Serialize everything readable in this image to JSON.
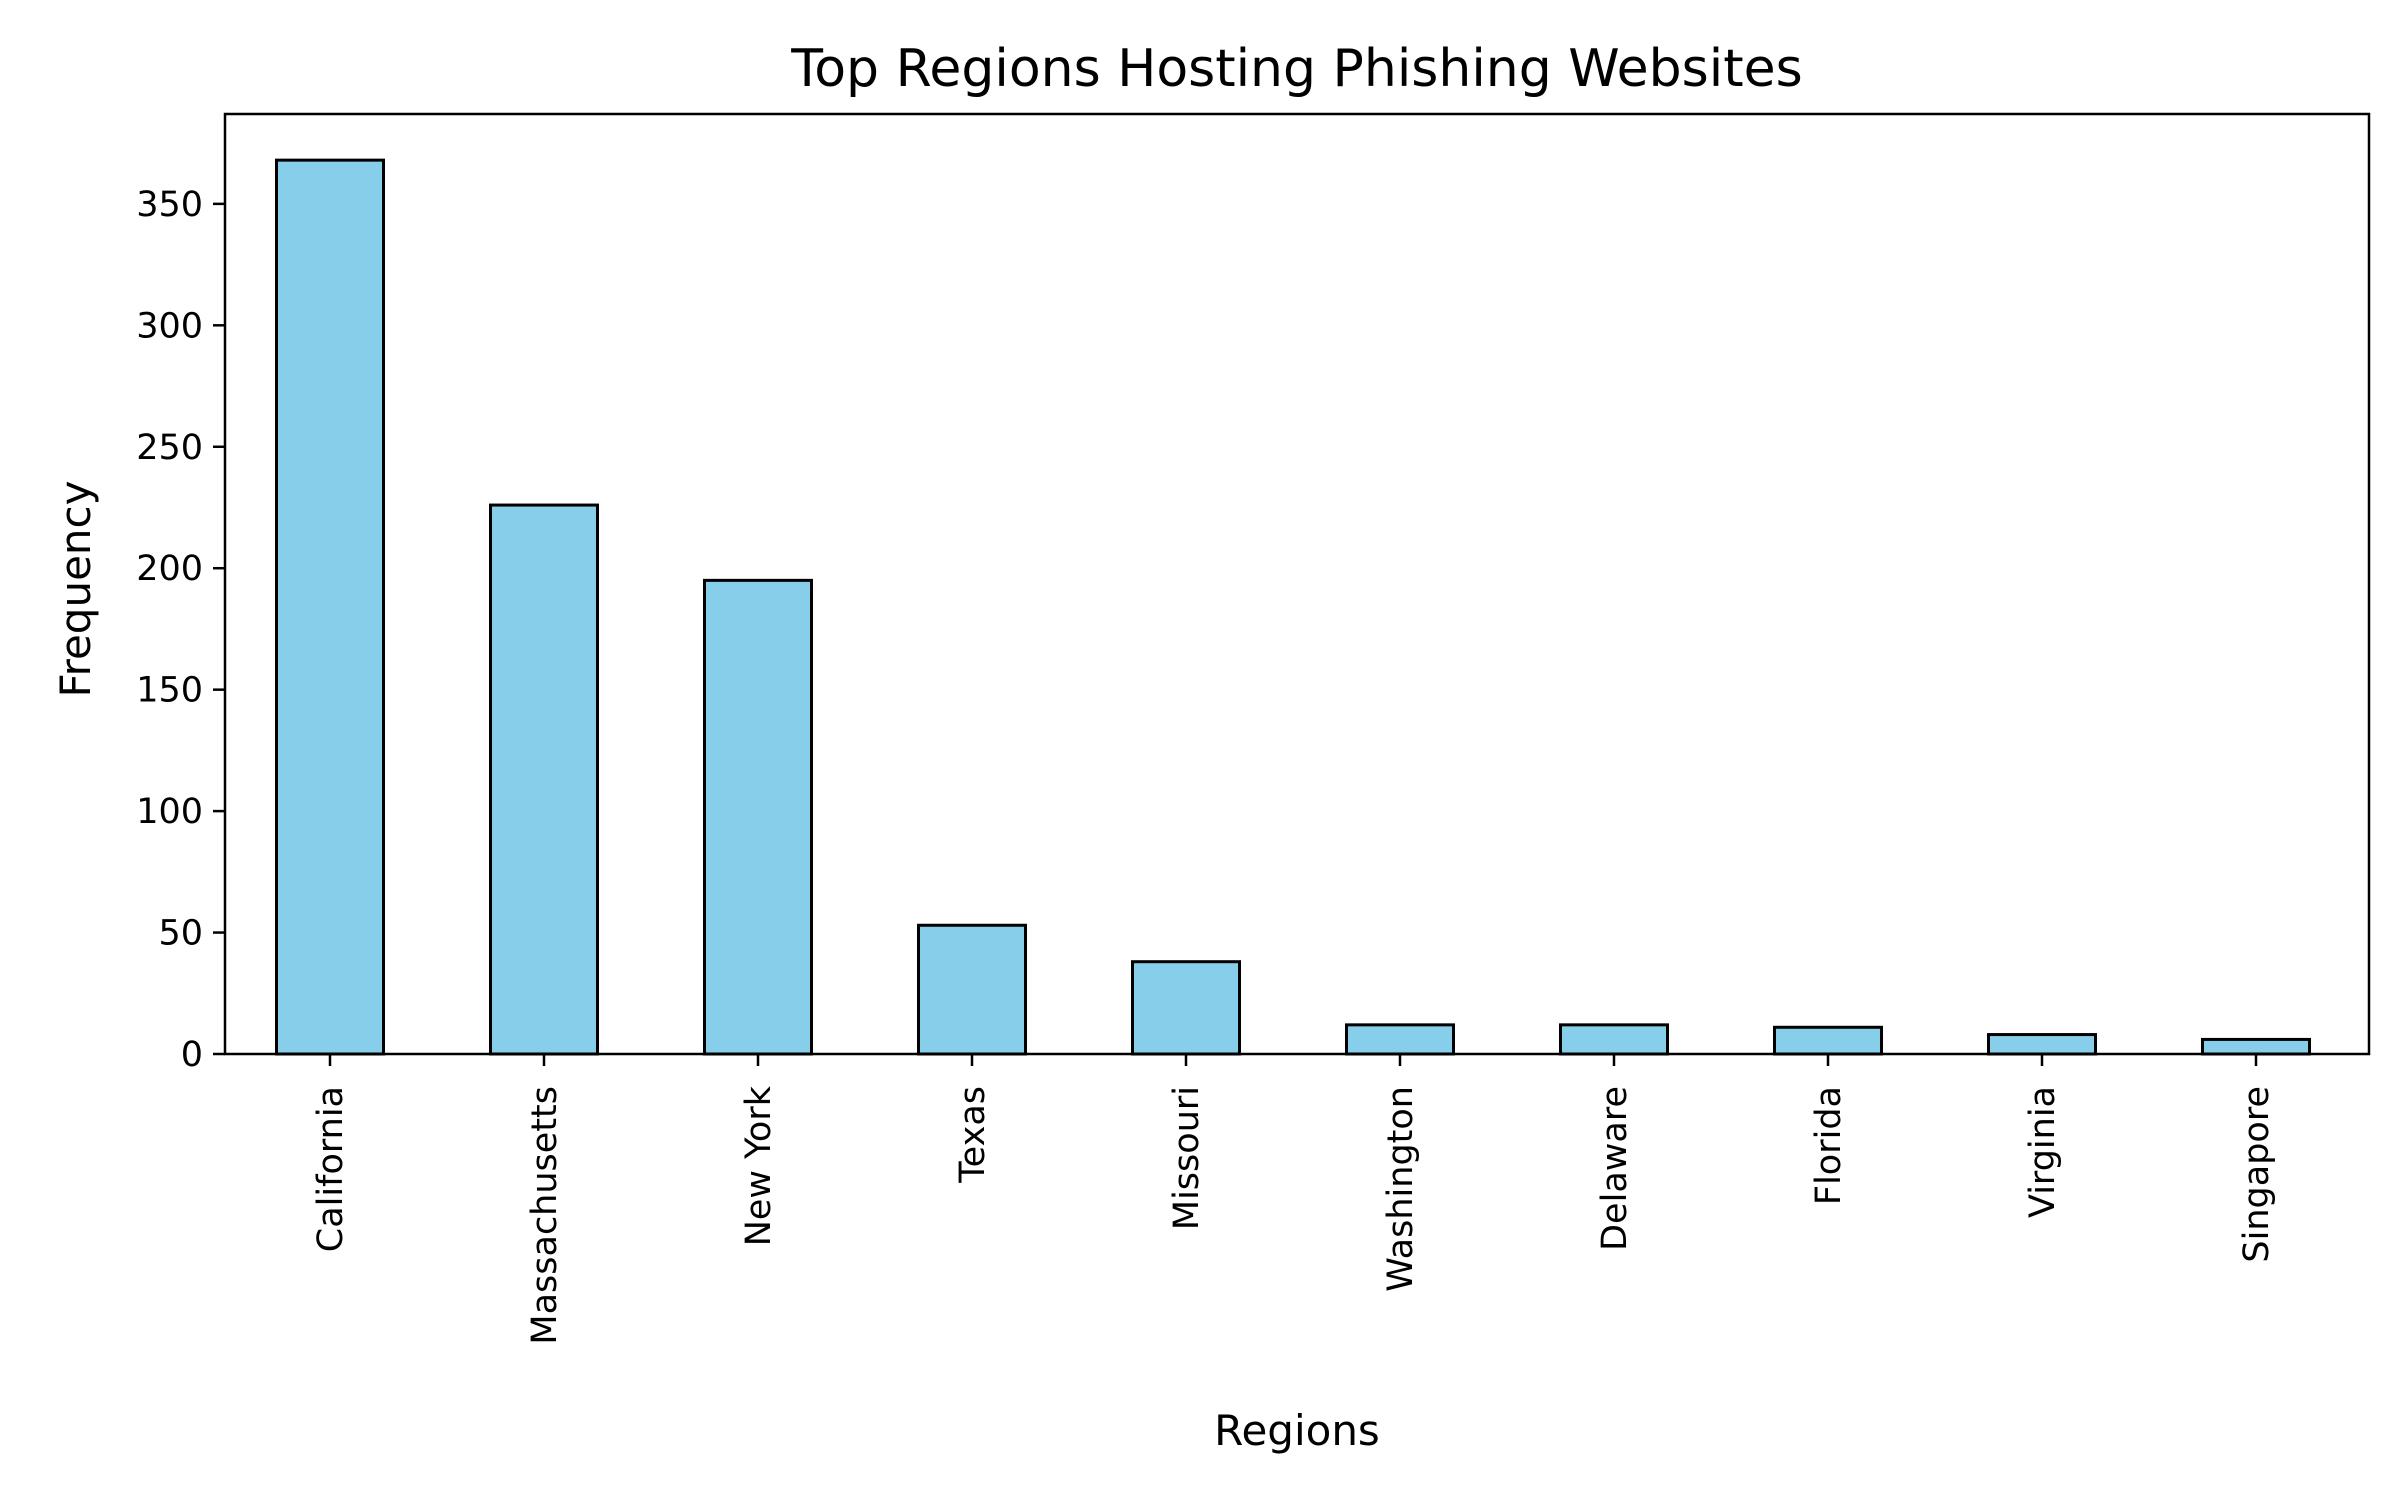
{
  "chart_data": {
    "type": "bar",
    "title": "Top Regions Hosting Phishing Websites",
    "xlabel": "Regions",
    "ylabel": "Frequency",
    "categories": [
      "California",
      "Massachusetts",
      "New York",
      "Texas",
      "Missouri",
      "Washington",
      "Delaware",
      "Florida",
      "Virginia",
      "Singapore"
    ],
    "values": [
      368,
      226,
      195,
      53,
      38,
      12,
      12,
      11,
      8,
      6
    ],
    "ylim": [
      0,
      387
    ],
    "yticks": [
      0,
      50,
      100,
      150,
      200,
      250,
      300,
      350
    ],
    "grid": false,
    "legend": "none",
    "bar_color": "#87CEEB",
    "edge_color": "#000000"
  }
}
